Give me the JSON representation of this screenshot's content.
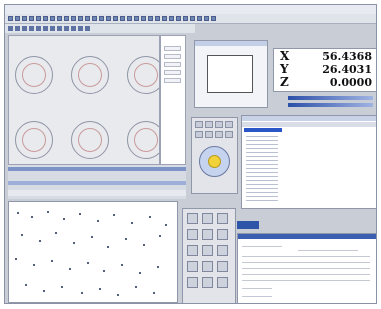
{
  "dro": {
    "x_label": "X",
    "x_value": "56.4368",
    "y_label": "Y",
    "y_value": "26.4031",
    "z_label": "Z",
    "z_value": "0.0000"
  }
}
